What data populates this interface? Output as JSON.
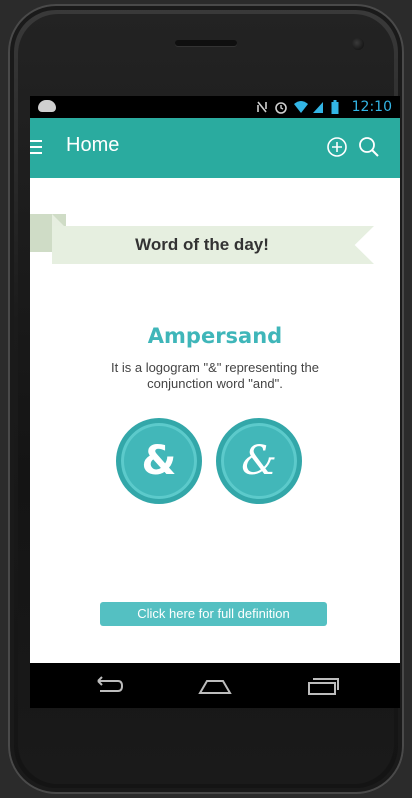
{
  "status_bar": {
    "time": "12:10",
    "icons": [
      "android-icon",
      "nfc-icon",
      "alarm-icon",
      "wifi-icon",
      "signal-icon",
      "battery-icon"
    ]
  },
  "app_bar": {
    "title": "Home",
    "actions": [
      "add-icon",
      "search-icon"
    ],
    "background": "#2aab9f"
  },
  "banner": {
    "text": "Word of the day!"
  },
  "word": {
    "title": "Ampersand",
    "description": "It is a logogram \"&\" representing the conjunction word \"and\".",
    "glyph_regular": "&",
    "glyph_italic": "&",
    "accent": "#42b7b9"
  },
  "cta": {
    "label": "Click here for full definition"
  },
  "nav": [
    "back-icon",
    "home-icon",
    "recents-icon"
  ]
}
